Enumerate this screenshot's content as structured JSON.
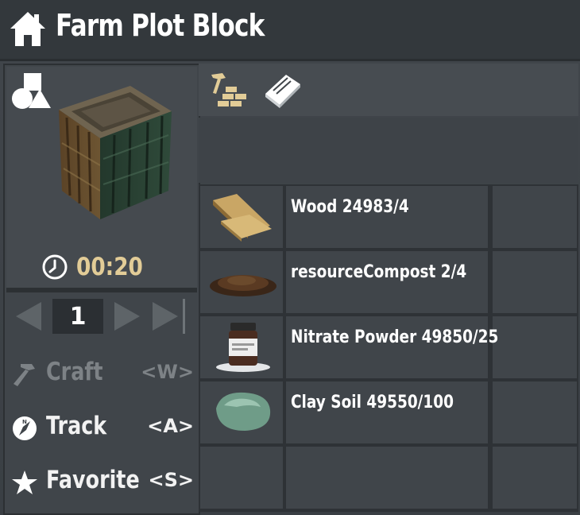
{
  "header": {
    "title": "Farm Plot Block",
    "icon": "house-icon"
  },
  "preview": {
    "shape_icon": "shapes-icon",
    "item_icon": "farm-plot-block-icon",
    "craft_time": "00:20",
    "timer_icon": "clock-icon"
  },
  "quantity": {
    "value": "1"
  },
  "actions": [
    {
      "label": "Craft",
      "key": "<W>",
      "icon": "hammer-icon",
      "enabled": false
    },
    {
      "label": "Track",
      "key": "<A>",
      "icon": "compass-icon",
      "enabled": true
    },
    {
      "label": "Favorite",
      "key": "<S>",
      "icon": "star-icon",
      "enabled": true
    }
  ],
  "tabs": [
    {
      "icon": "hammer-bricks-icon"
    },
    {
      "icon": "book-icon"
    }
  ],
  "ingredients": [
    {
      "name": "Wood 24983/4",
      "icon": "wood-planks-icon"
    },
    {
      "name": "resourceCompost 2/4",
      "icon": "compost-pile-icon"
    },
    {
      "name": "Nitrate Powder 49850/25",
      "icon": "nitrate-jar-icon"
    },
    {
      "name": "Clay Soil 49550/100",
      "icon": "clay-lump-icon"
    },
    {
      "name": "",
      "icon": ""
    }
  ],
  "colors": {
    "timer": "#e2cc97",
    "disabled": "#7d8286",
    "panel": "#40454a"
  }
}
